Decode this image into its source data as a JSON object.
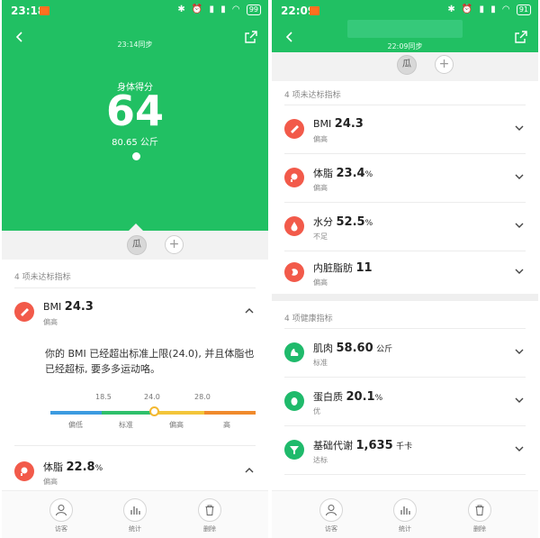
{
  "left": {
    "status": {
      "time": "23:18",
      "battery": "99"
    },
    "sync_text": "23:14同步",
    "score_label": "身体得分",
    "score": "64",
    "weight": "80.65 公斤",
    "user_avatar": "瓜",
    "section_title": "4 项未达标指标",
    "rows": [
      {
        "label": "BMI",
        "value": "24.3",
        "unit": "",
        "status": "偏高"
      },
      {
        "label": "体脂",
        "value": "22.8",
        "unit": "%",
        "status": "偏高"
      }
    ],
    "bmi_description": "你的 BMI 已经超出标准上限(24.0), 并且体脂也已经超标, 要多多运动咯。",
    "bmi_scale": {
      "ticks": [
        "18.5",
        "24.0",
        "28.0"
      ],
      "categories": [
        "偏低",
        "标准",
        "偏高",
        "高"
      ],
      "value": 24.3,
      "colors": [
        "#3c9be0",
        "#2fc06b",
        "#f3c53a",
        "#f08a2c"
      ]
    },
    "bottom_nav": [
      {
        "label": "访客",
        "icon": "person-icon"
      },
      {
        "label": "统计",
        "icon": "stats-icon"
      },
      {
        "label": "删除",
        "icon": "trash-icon"
      }
    ]
  },
  "right": {
    "status": {
      "time": "22:09",
      "battery": "91"
    },
    "sync_text": "22:09同步",
    "user_avatar": "瓜",
    "section1_title": "4 项未达标指标",
    "section1_rows": [
      {
        "label": "BMI",
        "value": "24.3",
        "unit": "",
        "status": "偏高",
        "icon": "bmi-icon"
      },
      {
        "label": "体脂",
        "value": "23.4",
        "unit": "%",
        "status": "偏高",
        "icon": "body-fat-icon"
      },
      {
        "label": "水分",
        "value": "52.5",
        "unit": "%",
        "status": "不足",
        "icon": "water-drop-icon"
      },
      {
        "label": "内脏脂肪",
        "value": "11",
        "unit": "",
        "status": "偏高",
        "icon": "visceral-fat-icon"
      }
    ],
    "section2_title": "4 项健康指标",
    "section2_rows": [
      {
        "label": "肌肉",
        "value": "58.60",
        "unit": "公斤",
        "status": "标准",
        "icon": "muscle-icon"
      },
      {
        "label": "蛋白质",
        "value": "20.1",
        "unit": "%",
        "status": "优",
        "icon": "protein-icon"
      },
      {
        "label": "基础代谢",
        "value": "1,635",
        "unit": "千卡",
        "status": "达标",
        "icon": "metabolism-icon"
      }
    ],
    "bottom_nav": [
      {
        "label": "访客",
        "icon": "person-icon"
      },
      {
        "label": "统计",
        "icon": "stats-icon"
      },
      {
        "label": "删除",
        "icon": "trash-icon"
      }
    ]
  },
  "colors": {
    "brand_green": "#21c063",
    "alert_red": "#f25a4a",
    "healthy_green": "#1fba6b"
  }
}
